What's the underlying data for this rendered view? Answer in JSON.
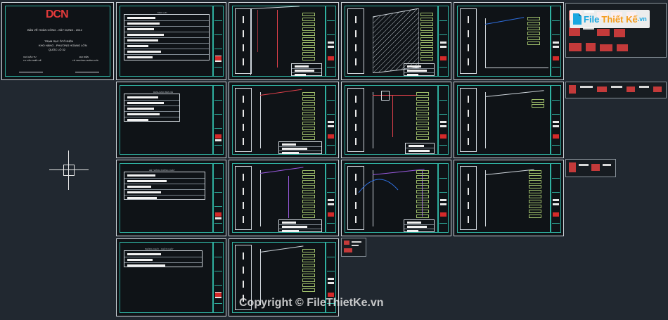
{
  "cover": {
    "logo": "DCN",
    "title": "BẢN VẼ HOÀN CÔNG - XÂY DỰNG - 2012",
    "project_1": "TRẠM SẠC ÔTÔ ĐIỆN",
    "project_2": "KHO HÀNG - PHƯƠNG HOÀNG LỚN",
    "project_3": "QUỐC LỘ 32",
    "left_label_1": "CHỦ ĐẦU TƯ",
    "left_label_2": "TƯ VẤN THIẾT KẾ",
    "right_label_1": "ĐẠI DIỆN",
    "right_label_2": "TỔ TRƯỞNG NHÓM LƯỚI"
  },
  "sheet_titles": {
    "list_1": "MỤC LỤC",
    "list_2": "DANH MỤC BẢN VẼ",
    "list_3": "HỆ THỐNG PHÒNG CHÁY",
    "list_4": "PHÒNG CHÁY - CHỮA CHÁY"
  },
  "brand": {
    "name_file": "File",
    "name_thiet": "Thiết Kế",
    "name_vn": ".vn"
  },
  "watermark": "Copyright © FileThietKe.vn",
  "colors": {
    "background": "#212830",
    "frame": "#2fb0a0",
    "accent_red": "#d42a2a",
    "wire_red": "#e0404a",
    "wire_purple": "#9a5ae0",
    "brand_blue": "#1aa7e0",
    "brand_orange": "#f39c1c"
  },
  "icons": {
    "crosshair": "crosshair-icon",
    "brand_logo": "filethietke-logo-icon"
  }
}
